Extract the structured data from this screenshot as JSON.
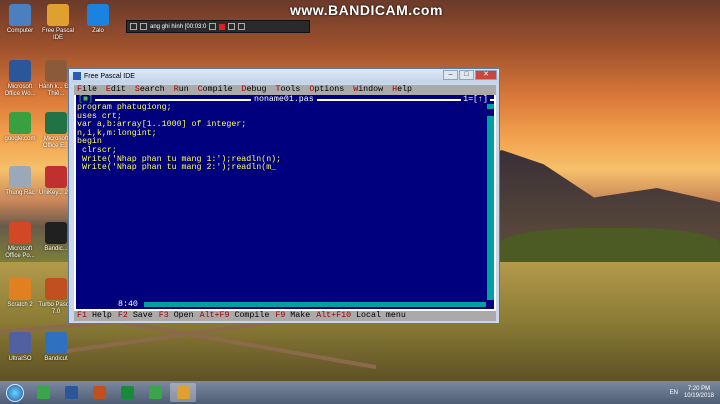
{
  "watermark": "www.BANDICAM.com",
  "recorder": {
    "status_text": "ang ghi hình [00:03:0"
  },
  "desktop_icons": [
    {
      "label": "Computer",
      "color": "#4a7fc0"
    },
    {
      "label": "Free Pascal IDE",
      "color": "#e0a030"
    },
    {
      "label": "Zalo",
      "color": "#1b82e0"
    },
    {
      "label": "Microsoft Office Wo...",
      "color": "#2b579a"
    },
    {
      "label": "Hành k... Đôi Thiê...",
      "color": "#8a5a3a"
    },
    {
      "label": "google.com",
      "color": "#38a040"
    },
    {
      "label": "Microsoft Office E...",
      "color": "#217346"
    },
    {
      "label": "Thùng Rác",
      "color": "#9aa8b8"
    },
    {
      "label": "UniKey... 2.0",
      "color": "#c03030"
    },
    {
      "label": "Microsoft Office Po...",
      "color": "#d24726"
    },
    {
      "label": "Bandic...",
      "color": "#202020"
    },
    {
      "label": "Scratch 2",
      "color": "#e08020"
    },
    {
      "label": "Turbo Pascal 7.0",
      "color": "#c05020"
    },
    {
      "label": "UltraISO",
      "color": "#5060a0"
    },
    {
      "label": "Bandicut",
      "color": "#3070c0"
    }
  ],
  "window": {
    "title": "Free Pascal IDE",
    "buttons": {
      "minimize": "–",
      "maximize": "□",
      "close": "✕"
    }
  },
  "ide": {
    "menu": [
      {
        "hk": "F",
        "rest": "ile"
      },
      {
        "hk": "E",
        "rest": "dit"
      },
      {
        "hk": "S",
        "rest": "earch"
      },
      {
        "hk": "R",
        "rest": "un"
      },
      {
        "hk": "C",
        "rest": "ompile"
      },
      {
        "hk": "D",
        "rest": "ebug"
      },
      {
        "hk": "T",
        "rest": "ools"
      },
      {
        "hk": "O",
        "rest": "ptions"
      },
      {
        "hk": "W",
        "rest": "indow"
      },
      {
        "hk": "H",
        "rest": "elp"
      }
    ],
    "editor": {
      "close_box": "[■]",
      "filename": "noname01.pas",
      "window_number": "1=[↑]",
      "cursor_pos": "8:40"
    },
    "status": [
      {
        "hk": "F1",
        "rest": " Help"
      },
      {
        "hk": "F2",
        "rest": " Save"
      },
      {
        "hk": "F3",
        "rest": " Open"
      },
      {
        "hk": "Alt+F9",
        "rest": " Compile"
      },
      {
        "hk": "F9",
        "rest": " Make"
      },
      {
        "hk": "Alt+F10",
        "rest": " Local menu"
      }
    ]
  },
  "code_lines": [
    "program phatugiong;",
    "uses crt;",
    "var a,b:array[1..1000] of integer;",
    "n,i,k,m:longint;",
    "begin",
    " clrscr;",
    " Write('Nhap phan tu mang 1:');readln(n);",
    " Write('Nhap phan tu mang 2:');readln(m_"
  ],
  "taskbar": {
    "apps": [
      {
        "name": "chrome",
        "color": "#3aa64a"
      },
      {
        "name": "word",
        "color": "#2b579a"
      },
      {
        "name": "turbo-pascal",
        "color": "#c05020"
      },
      {
        "name": "unikey",
        "color": "#1a8a3a"
      },
      {
        "name": "chrome-2",
        "color": "#3aa64a"
      },
      {
        "name": "free-pascal",
        "color": "#e0a030"
      }
    ],
    "language": "EN",
    "time": "7:20 PM",
    "date": "10/19/2018"
  }
}
